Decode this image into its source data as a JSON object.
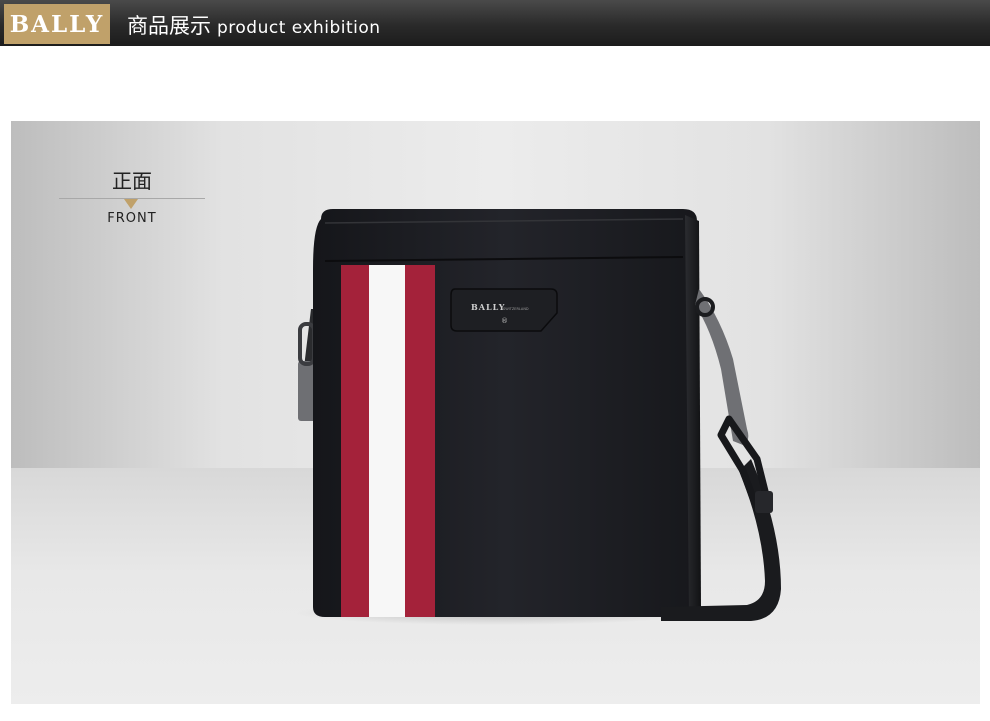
{
  "header": {
    "brand": "BALLY",
    "title_cn": "商品展示",
    "title_en": "product exhibition"
  },
  "view": {
    "label_cn": "正面",
    "label_en": "FRONT"
  },
  "bag": {
    "logo_text": "BALLY",
    "logo_subtext": "SWITZERLAND",
    "logo_mark": "®"
  },
  "colors": {
    "accent_gold": "#c0a16a",
    "header_dark": "#2a2a2a",
    "stripe_red": "#a4223a",
    "stripe_white": "#ffffff",
    "bag_black": "#1b1c20"
  }
}
